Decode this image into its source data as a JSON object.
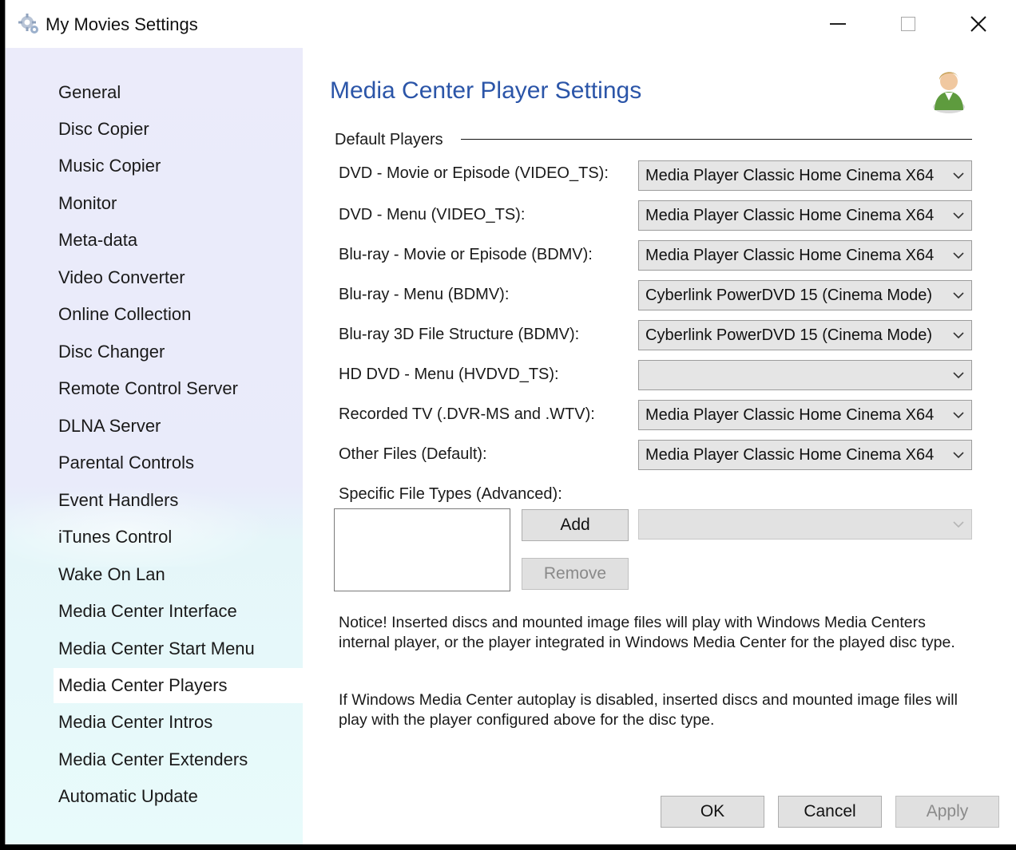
{
  "window": {
    "title": "My Movies Settings",
    "icon": "gear-icon",
    "controls": {
      "minimize": "minimize-icon",
      "maximize": "maximize-icon",
      "close": "close-icon"
    }
  },
  "sidebar": {
    "selected": "Media Center Players",
    "items": [
      {
        "label": "General"
      },
      {
        "label": "Disc Copier"
      },
      {
        "label": "Music Copier"
      },
      {
        "label": "Monitor"
      },
      {
        "label": "Meta-data"
      },
      {
        "label": "Video Converter"
      },
      {
        "label": "Online Collection"
      },
      {
        "label": "Disc Changer"
      },
      {
        "label": "Remote Control Server"
      },
      {
        "label": "DLNA Server"
      },
      {
        "label": "Parental Controls"
      },
      {
        "label": "Event Handlers"
      },
      {
        "label": "iTunes Control"
      },
      {
        "label": "Wake On Lan"
      },
      {
        "label": "Media Center Interface"
      },
      {
        "label": "Media Center Start Menu"
      },
      {
        "label": "Media Center Players"
      },
      {
        "label": "Media Center Intros"
      },
      {
        "label": "Media Center Extenders"
      },
      {
        "label": "Automatic Update"
      }
    ]
  },
  "main": {
    "title": "Media Center Player Settings",
    "title_color": "#2b55a8",
    "header_icon": "user-icon",
    "section": "Default Players",
    "rows": [
      {
        "label": "DVD - Movie or Episode (VIDEO_TS):",
        "value": "Media Player Classic Home Cinema X64"
      },
      {
        "label": "DVD - Menu (VIDEO_TS):",
        "value": "Media Player Classic Home Cinema X64"
      },
      {
        "label": "Blu-ray - Movie or Episode (BDMV):",
        "value": "Media Player Classic Home Cinema X64"
      },
      {
        "label": "Blu-ray - Menu (BDMV):",
        "value": "Cyberlink PowerDVD 15 (Cinema Mode)"
      },
      {
        "label": "Blu-ray 3D File Structure (BDMV):",
        "value": "Cyberlink PowerDVD 15 (Cinema Mode)"
      },
      {
        "label": "HD DVD - Menu (HVDVD_TS):",
        "value": ""
      },
      {
        "label": "Recorded TV (.DVR-MS and .WTV):",
        "value": "Media Player Classic Home Cinema X64"
      },
      {
        "label": "Other Files (Default):",
        "value": "Media Player Classic Home Cinema X64"
      }
    ],
    "specific": {
      "label": "Specific File Types (Advanced):",
      "add_label": "Add",
      "remove_label": "Remove",
      "combo_value": ""
    },
    "notice1": "Notice! Inserted discs and mounted image files will play with Windows Media Centers internal player, or the player integrated in Windows Media Center for the played disc type.",
    "notice2": "If Windows Media Center autoplay is disabled, inserted discs and mounted image files will play with the player configured above for the disc type."
  },
  "footer": {
    "ok_label": "OK",
    "cancel_label": "Cancel",
    "apply_label": "Apply"
  }
}
